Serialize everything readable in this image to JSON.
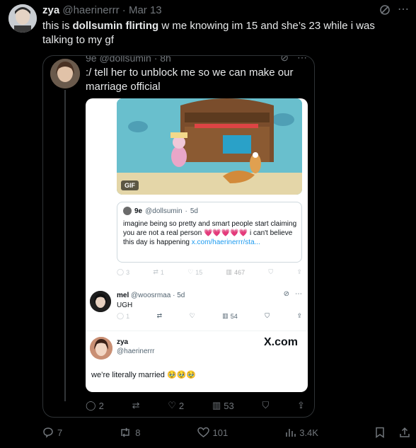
{
  "tweet": {
    "name": "zya",
    "handle": "@haerinerrr",
    "date": "Mar 13",
    "text_before": "this is ",
    "text_bold": "dollsumin flirting",
    "text_after": " w me knowing im 15 and she’s 23 while i was talking to my gf",
    "replies": "7",
    "reposts": "8",
    "likes": "101",
    "views": "3.4K"
  },
  "screenshot": {
    "header": "9e @dollsumin · 8h",
    "text": ":/ tell her to unblock me so we can make our marriage official",
    "replies": "2",
    "likes": "2",
    "views": "53",
    "card": {
      "gif_badge": "GIF",
      "quote": {
        "name": "9e",
        "handle": "@dollsumin",
        "time": "5d",
        "text": "imagine being so pretty and smart people start claiming you are not a real person",
        "hearts": "💗💗💗💗💗",
        "text_tail": " i can't believe this day is happening ",
        "link": "x.com/haerinerrr/sta..."
      },
      "quote_stats": {
        "replies": "3",
        "reposts": "1",
        "likes": "15",
        "views": "467"
      },
      "reply": {
        "name": "mel",
        "handle": "@woosrmaa",
        "time": "5d",
        "text": "UGH",
        "stats": {
          "replies": "1",
          "views": "54"
        }
      },
      "zya": {
        "name": "zya",
        "handle": "@haerinerrr",
        "brand": "X.com",
        "text": "we’re literally married 🥹🥹🥹"
      }
    }
  }
}
